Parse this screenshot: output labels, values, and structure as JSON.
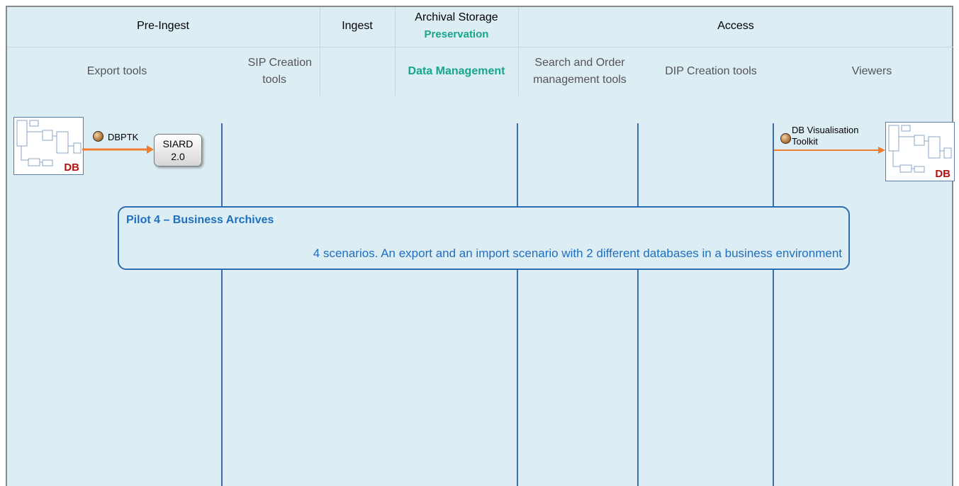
{
  "header": {
    "pre_ingest": "Pre-Ingest",
    "ingest": "Ingest",
    "archival_storage": "Archival Storage",
    "preservation": "Preservation",
    "access": "Access"
  },
  "subheader": {
    "export_tools": "Export tools",
    "sip_creation_line1": "SIP Creation",
    "sip_creation_line2": "tools",
    "data_management": "Data Management",
    "search_order_line1": "Search and Order",
    "search_order_line2": "management tools",
    "dip_creation": "DIP Creation tools",
    "viewers": "Viewers"
  },
  "flow": {
    "db_label_left": "DB",
    "dbptk": "DBPTK",
    "siard_line1": "SIARD",
    "siard_line2": "2.0",
    "visualisation_line1": "DB Visualisation",
    "visualisation_line2": "Toolkit",
    "db_label_right": "DB"
  },
  "pilot": {
    "title": "Pilot 4 – Business Archives",
    "description": "4 scenarios. An export and an import scenario with 2 different databases in a business environment"
  },
  "colors": {
    "background": "#dcedf4",
    "lane_line": "#3a6fae",
    "teal_accent": "#17a58c",
    "arrow": "#ed7d31",
    "pilot_text": "#1f6fc0",
    "db_label": "#b01010"
  }
}
